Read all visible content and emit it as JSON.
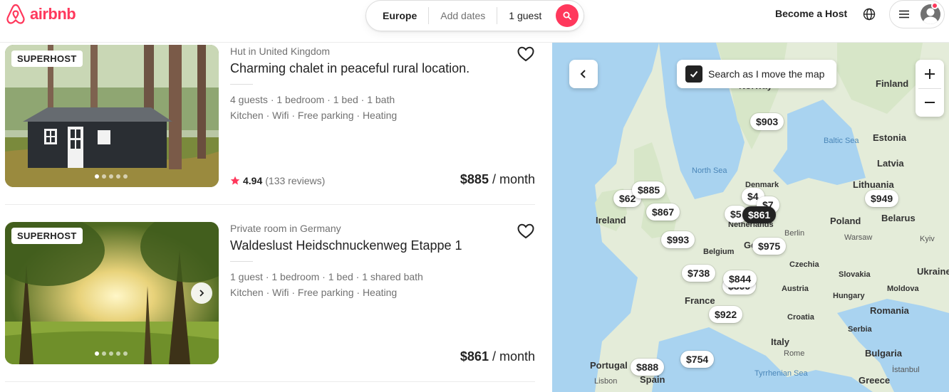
{
  "header": {
    "logo_text": "airbnb",
    "search": {
      "location": "Europe",
      "dates": "Add dates",
      "guests": "1 guest"
    },
    "become_host": "Become a Host"
  },
  "listings": [
    {
      "badge": "SUPERHOST",
      "type": "Hut in United Kingdom",
      "title": "Charming chalet in peaceful rural location.",
      "rooms": "4 guests · 1 bedroom · 1 bed · 1 bath",
      "amenities": "Kitchen · Wifi · Free parking · Heating",
      "rating": "4.94",
      "reviews": "(133 reviews)",
      "price": "$885",
      "price_unit": "/ month"
    },
    {
      "badge": "SUPERHOST",
      "type": "Private room in Germany",
      "title": "Waldeslust Heidschnuckenweg Etappe 1",
      "rooms": "1 guest · 1 bedroom · 1 bed · 1 shared bath",
      "amenities": "Kitchen · Wifi · Free parking · Heating",
      "price": "$861",
      "price_unit": "/ month"
    }
  ],
  "map": {
    "search_as_move": "Search as I move the map",
    "pins": [
      "$903",
      "$885",
      "$62",
      "$867",
      "$5",
      "$861",
      "$4",
      "$7",
      "$993",
      "$975",
      "$949",
      "$738",
      "$844",
      "$922",
      "$754",
      "$888",
      "$800"
    ],
    "labels": {
      "norway": "Norway",
      "finland": "Finland",
      "estonia": "Estonia",
      "latvia": "Latvia",
      "lithuania": "Lithuania",
      "baltic_sea": "Baltic Sea",
      "north_sea": "North Sea",
      "denmark": "Denmark",
      "ireland": "Ireland",
      "netherlands": "Netherlands",
      "berlin": "Berlin",
      "poland": "Poland",
      "warsaw": "Warsaw",
      "belarus": "Belarus",
      "kyiv": "Kyiv",
      "belgium": "Belgium",
      "ge": "Ge",
      "czechia": "Czechia",
      "slovakia": "Slovakia",
      "ukraine": "Ukraine",
      "austria": "Austria",
      "hungary": "Hungary",
      "moldova": "Moldova",
      "france": "France",
      "croatia": "Croatia",
      "romania": "Romania",
      "serbia": "Serbia",
      "italy": "Italy",
      "rome": "Rome",
      "bulgaria": "Bulgaria",
      "portugal": "Portugal",
      "spain": "Spain",
      "lisbon": "Lisbon",
      "tyrrhenian": "Tyrrhenian Sea",
      "istanbul": "İstanbul",
      "greece": "Greece",
      "london": "n"
    }
  },
  "colors": {
    "brand": "#ff385c",
    "text": "#222222",
    "muted": "#717171",
    "rating_star": "#ff385c"
  }
}
